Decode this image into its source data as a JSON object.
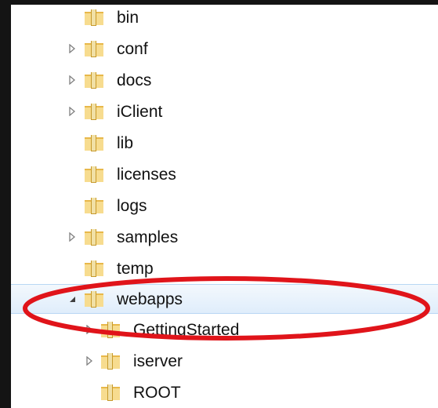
{
  "tree": {
    "items": [
      {
        "label": "bin",
        "expander": "none"
      },
      {
        "label": "conf",
        "expander": "collapsed"
      },
      {
        "label": "docs",
        "expander": "collapsed"
      },
      {
        "label": "iClient",
        "expander": "collapsed"
      },
      {
        "label": "lib",
        "expander": "none"
      },
      {
        "label": "licenses",
        "expander": "none"
      },
      {
        "label": "logs",
        "expander": "none"
      },
      {
        "label": "samples",
        "expander": "collapsed"
      },
      {
        "label": "temp",
        "expander": "none"
      },
      {
        "label": "webapps",
        "expander": "expanded",
        "selected": true
      },
      {
        "label": "GettingStarted",
        "expander": "collapsed"
      },
      {
        "label": "iserver",
        "expander": "collapsed"
      },
      {
        "label": "ROOT",
        "expander": "none"
      }
    ]
  },
  "icons": {
    "folder": "folder-icon",
    "collapsed": "chevron-right-icon",
    "expanded": "chevron-down-icon",
    "annotation": "red-ellipse-highlight"
  },
  "colors": {
    "selection_bg": "#dfedfb",
    "selection_border": "#b9d7f4",
    "folder_yellow": "#f3d27a",
    "annotation_red": "#e0141a"
  }
}
